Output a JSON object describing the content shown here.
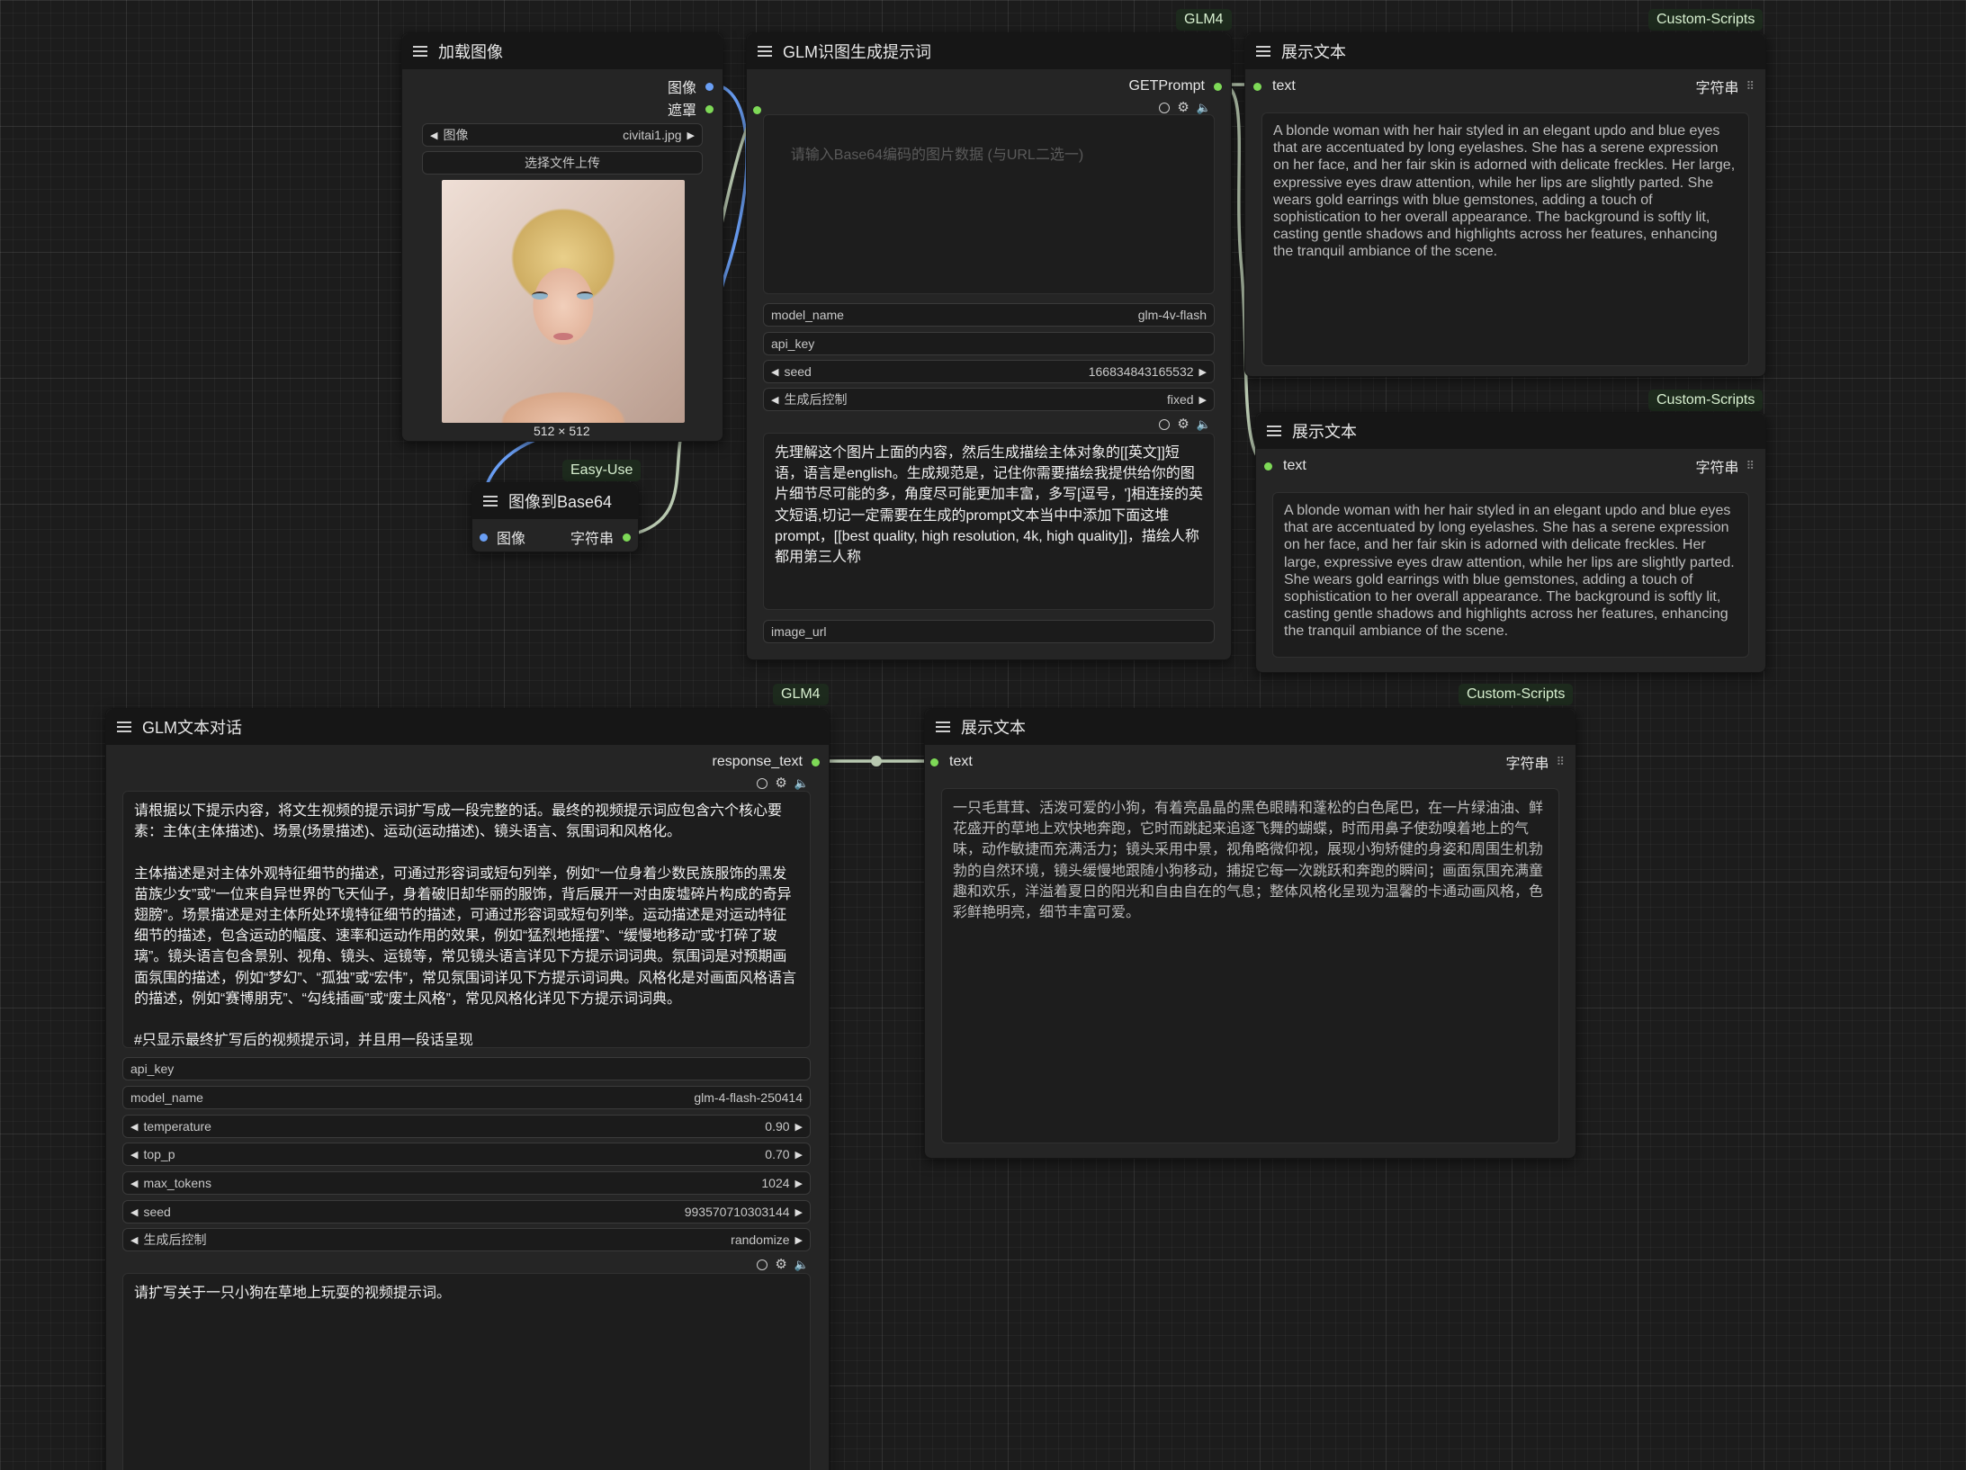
{
  "load_image": {
    "title": "加载图像",
    "out_image": "图像",
    "out_mask": "遮罩",
    "image_label": "图像",
    "image_value": "civitai1.jpg",
    "upload_button": "选择文件上传",
    "preview_size": "512 × 512"
  },
  "img2b64": {
    "badge": "Easy-Use",
    "title": "图像到Base64",
    "in_image": "图像",
    "out_string": "字符串"
  },
  "glm_vision": {
    "badge": "GLM4",
    "title": "GLM识图生成提示词",
    "output": "GETPrompt",
    "image_data_placeholder": "请输入Base64编码的图片数据 (与URL二选一)",
    "model_name_label": "model_name",
    "model_name_value": "glm-4v-flash",
    "api_key_label": "api_key",
    "seed_label": "seed",
    "seed_value": "166834843165532",
    "control_label": "生成后控制",
    "control_value": "fixed",
    "prompt": "先理解这个图片上面的内容，然后生成描绘主体对象的[[英文]]短语，语言是english。生成规范是，记住你需要描绘我提供给你的图片细节尽可能的多，角度尽可能更加丰富，多写[逗号，']相连接的英文短语,切记一定需要在生成的prompt文本当中中添加下面这堆prompt，[[best quality, high resolution, 4k, high quality]]，描绘人称都用第三人称",
    "image_url_label": "image_url"
  },
  "show_text_1": {
    "badge": "Custom-Scripts",
    "title": "展示文本",
    "input": "text",
    "output": "字符串",
    "text": "A blonde woman with her hair styled in an elegant updo and blue eyes that are accentuated by long eyelashes. She has a serene expression on her face, and her fair skin is adorned with delicate freckles. Her large, expressive eyes draw attention, while her lips are slightly parted. She wears gold earrings with blue gemstones, adding a touch of sophistication to her overall appearance. The background is softly lit, casting gentle shadows and highlights across her features, enhancing the tranquil ambiance of the scene."
  },
  "show_text_2": {
    "badge": "Custom-Scripts",
    "title": "展示文本",
    "input": "text",
    "output": "字符串",
    "text": "A blonde woman with her hair styled in an elegant updo and blue eyes that are accentuated by long eyelashes. She has a serene expression on her face, and her fair skin is adorned with delicate freckles. Her large, expressive eyes draw attention, while her lips are slightly parted. She wears gold earrings with blue gemstones, adding a touch of sophistication to her overall appearance. The background is softly lit, casting gentle shadows and highlights across her features, enhancing the tranquil ambiance of the scene."
  },
  "glm_chat": {
    "badge": "GLM4",
    "title": "GLM文本对话",
    "output": "response_text",
    "system_prompt": "请根据以下提示内容，将文生视频的提示词扩写成一段完整的话。最终的视频提示词应包含六个核心要素：主体(主体描述)、场景(场景描述)、运动(运动描述)、镜头语言、氛围词和风格化。\n\n主体描述是对主体外观特征细节的描述，可通过形容词或短句列举，例如“一位身着少数民族服饰的黑发苗族少女”或“一位来自异世界的飞天仙子，身着破旧却华丽的服饰，背后展开一对由废墟碎片构成的奇异翅膀”。场景描述是对主体所处环境特征细节的描述，可通过形容词或短句列举。运动描述是对运动特征细节的描述，包含运动的幅度、速率和运动作用的效果，例如“猛烈地摇摆”、“缓慢地移动”或“打碎了玻璃”。镜头语言包含景别、视角、镜头、运镜等，常见镜头语言详见下方提示词词典。氛围词是对预期画面氛围的描述，例如“梦幻”、“孤独”或“宏伟”，常见氛围词详见下方提示词词典。风格化是对画面风格语言的描述，例如“赛博朋克”、“勾线插画”或“废土风格”，常见风格化详见下方提示词词典。\n\n#只显示最终扩写后的视频提示词，并且用一段话呈现",
    "api_key_label": "api_key",
    "model_name_label": "model_name",
    "model_name_value": "glm-4-flash-250414",
    "temperature_label": "temperature",
    "temperature_value": "0.90",
    "top_p_label": "top_p",
    "top_p_value": "0.70",
    "max_tokens_label": "max_tokens",
    "max_tokens_value": "1024",
    "seed_label": "seed",
    "seed_value": "993570710303144",
    "control_label": "生成后控制",
    "control_value": "randomize",
    "user_prompt": "请扩写关于一只小狗在草地上玩耍的视频提示词。"
  },
  "show_text_3": {
    "badge": "Custom-Scripts",
    "title": "展示文本",
    "input": "text",
    "output": "字符串",
    "text": "一只毛茸茸、活泼可爱的小狗，有着亮晶晶的黑色眼睛和蓬松的白色尾巴，在一片绿油油、鲜花盛开的草地上欢快地奔跑，它时而跳起来追逐飞舞的蝴蝶，时而用鼻子使劲嗅着地上的气味，动作敏捷而充满活力；镜头采用中景，视角略微仰视，展现小狗矫健的身姿和周围生机勃勃的自然环境，镜头缓慢地跟随小狗移动，捕捉它每一次跳跃和奔跑的瞬间；画面氛围充满童趣和欢乐，洋溢着夏日的阳光和自由自在的气息；整体风格化呈现为温馨的卡通动画风格，色彩鲜艳明亮，细节丰富可爱。"
  }
}
